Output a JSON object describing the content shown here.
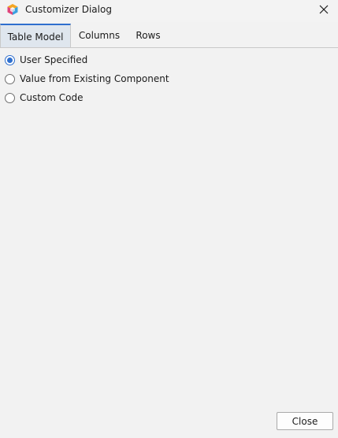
{
  "window": {
    "title": "Customizer Dialog",
    "app_icon": "netbeans-cube-icon",
    "close_icon": "close-icon"
  },
  "tabs": [
    {
      "label": "Table Model",
      "active": true
    },
    {
      "label": "Columns",
      "active": false
    },
    {
      "label": "Rows",
      "active": false
    }
  ],
  "options": [
    {
      "label": "User Specified",
      "selected": true
    },
    {
      "label": "Value from Existing Component",
      "selected": false
    },
    {
      "label": "Custom Code",
      "selected": false
    }
  ],
  "footer": {
    "close_label": "Close"
  },
  "colors": {
    "accent": "#2f6fce",
    "active_tab_bg": "#dfe6ee",
    "background": "#f2f2f2"
  }
}
